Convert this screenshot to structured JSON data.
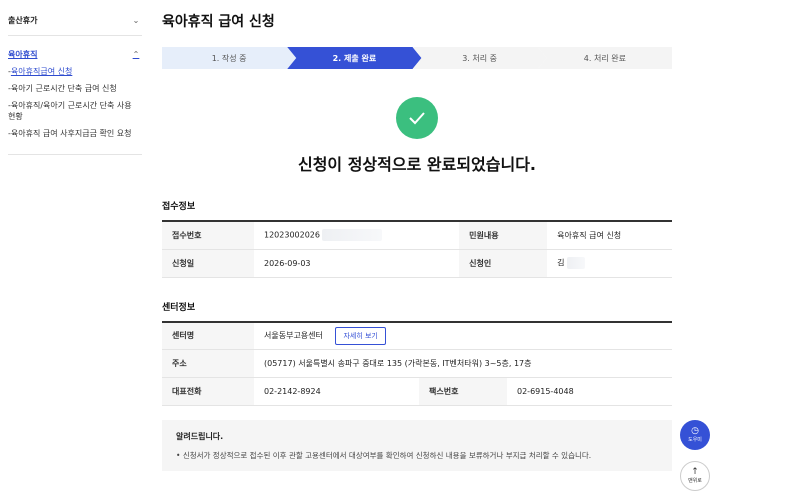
{
  "sidebar": {
    "groups": [
      {
        "label": "출산휴가",
        "expanded": false
      },
      {
        "label": "육아휴직",
        "expanded": true
      }
    ],
    "items": [
      {
        "label": "육아휴직급여 신청",
        "active": true
      },
      {
        "label": "육아기 근로시간 단축 급여 신청",
        "active": false
      },
      {
        "label": "육아휴직/육아기 근로시간 단축 사용 현황",
        "active": false
      },
      {
        "label": "육아휴직 급여 사후지급금 확인 요청",
        "active": false
      }
    ]
  },
  "page": {
    "title": "육아휴직 급여 신청",
    "steps": [
      "1. 작성 중",
      "2. 제출 완료",
      "3. 처리 중",
      "4. 처리 완료"
    ],
    "current_step": 2,
    "done_message": "신청이 정상적으로 완료되었습니다."
  },
  "receipt": {
    "title": "접수정보",
    "receipt_no_label": "접수번호",
    "receipt_no": "12023002026",
    "content_label": "민원내용",
    "content": "육아휴직 급여 신청",
    "date_label": "신청일",
    "date": "2026-09-03",
    "applicant_label": "신청인",
    "applicant": "김"
  },
  "center": {
    "title": "센터정보",
    "name_label": "센터명",
    "name": "서울동부고용센터",
    "detail_button": "자세히 보기",
    "address_label": "주소",
    "address": "(05717) 서울특별시 송파구 중대로 135 (가락본동, IT벤처타워) 3~5층, 17층",
    "phone_label": "대표전화",
    "phone": "02-2142-8924",
    "fax_label": "팩스번호",
    "fax": "02-6915-4048"
  },
  "notice": {
    "title": "알려드립니다.",
    "items": [
      "신청서가 정상적으로 접수된 이후 관할 고용센터에서 대상여부를 확인하여 신청하신 내용을 보류하거나 부지급 처리할 수 있습니다."
    ]
  },
  "floating": {
    "help_label": "도우미",
    "top_label": "맨위로"
  },
  "colors": {
    "accent": "#3551d6",
    "success": "#3bbf7f",
    "step_done": "#e6eefa"
  }
}
